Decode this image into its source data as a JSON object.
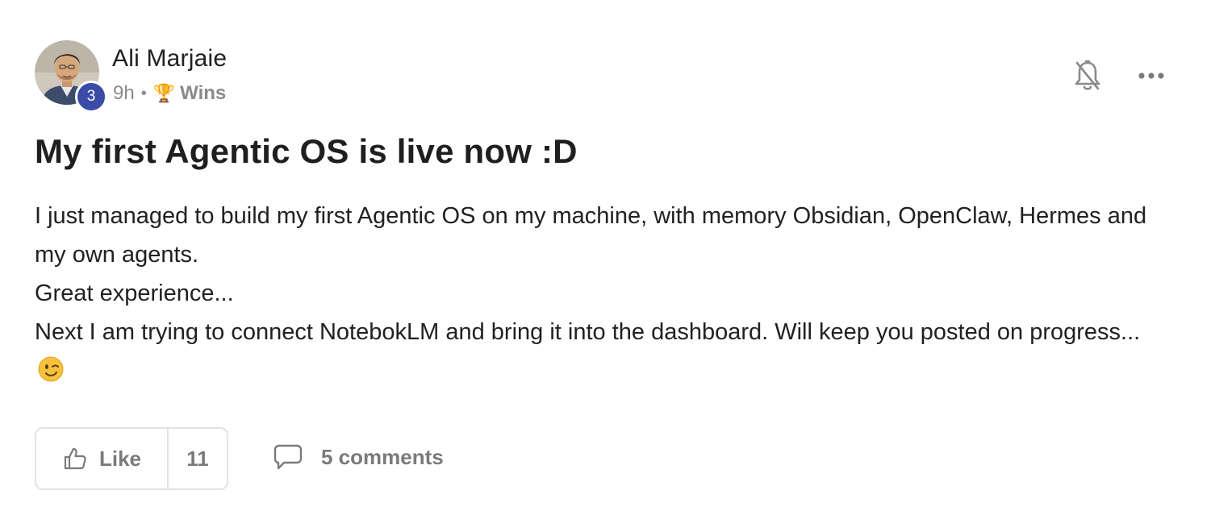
{
  "author": {
    "name": "Ali Marjaie",
    "level": "3",
    "time_ago": "9h",
    "separator": "•",
    "category_icon": "🏆",
    "category": "Wins"
  },
  "actions": {
    "notify_icon": "bell-off-icon",
    "more_icon": "more-horizontal-icon"
  },
  "post": {
    "title": "My first Agentic OS is live now :D",
    "body_lines": [
      "I just managed to build my first Agentic OS on my machine, with memory Obsidian, OpenClaw, Hermes and my own agents.",
      "Great experience...",
      "Next I am trying to connect NotebokLM and bring it into the dashboard. Will keep you posted on progress..."
    ],
    "emoji_icon": "winking-face-icon"
  },
  "footer": {
    "like_label": "Like",
    "like_count": "11",
    "comments_label": "5 comments"
  },
  "colors": {
    "badge": "#3b4ba8",
    "muted_text": "#8a8a8a",
    "border": "#e3e3e3"
  }
}
